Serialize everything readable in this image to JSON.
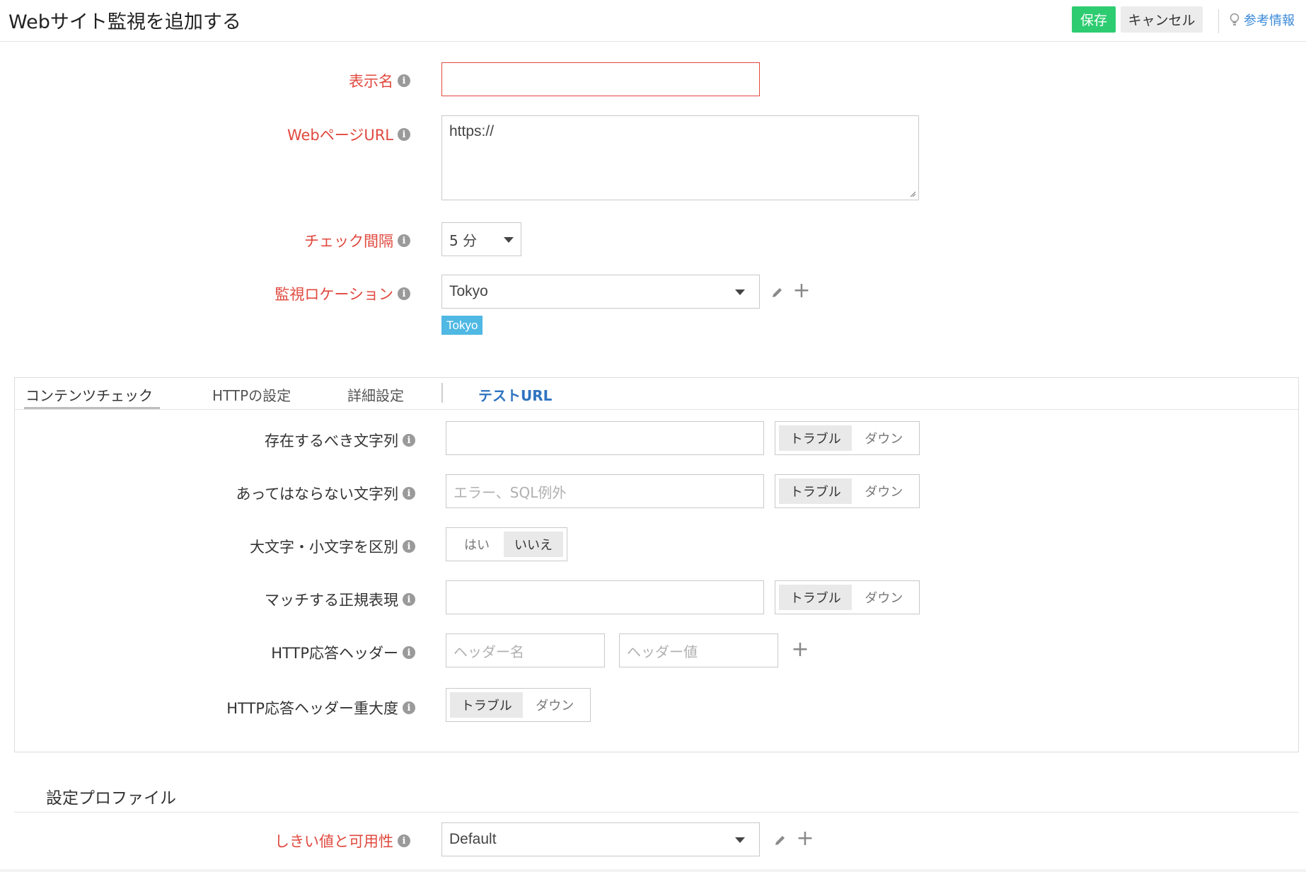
{
  "header": {
    "title": "Webサイト監視を追加する",
    "save_label": "保存",
    "cancel_label": "キャンセル",
    "help_label": "参考情報"
  },
  "form": {
    "display_name": {
      "label": "表示名",
      "value": ""
    },
    "url": {
      "label": "WebページURL",
      "value": "https://"
    },
    "interval": {
      "label": "チェック間隔",
      "value": "5 分"
    },
    "location": {
      "label": "監視ロケーション",
      "value": "Tokyo",
      "tag": "Tokyo"
    }
  },
  "tabs": [
    {
      "label": "コンテンツチェック",
      "active": true
    },
    {
      "label": "HTTPの設定",
      "active": false
    },
    {
      "label": "詳細設定",
      "active": false
    },
    {
      "label": "テストURL",
      "active": false
    }
  ],
  "content": {
    "should_contain": {
      "label": "存在するべき文字列",
      "value": "",
      "opt1": "トラブル",
      "opt2": "ダウン"
    },
    "should_not_contain": {
      "label": "あってはならない文字列",
      "placeholder": "エラー、SQL例外",
      "opt1": "トラブル",
      "opt2": "ダウン"
    },
    "case_sensitive": {
      "label": "大文字・小文字を区別",
      "opt1": "はい",
      "opt2": "いいえ"
    },
    "regex": {
      "label": "マッチする正規表現",
      "value": "",
      "opt1": "トラブル",
      "opt2": "ダウン"
    },
    "http_header": {
      "label": "HTTP応答ヘッダー",
      "name_placeholder": "ヘッダー名",
      "value_placeholder": "ヘッダー値"
    },
    "http_header_severity": {
      "label": "HTTP応答ヘッダー重大度",
      "opt1": "トラブル",
      "opt2": "ダウン"
    }
  },
  "profile": {
    "section_title": "設定プロファイル",
    "threshold": {
      "label": "しきい値と可用性",
      "value": "Default"
    }
  },
  "colors": {
    "required_label": "#e0493e",
    "save_button": "#2ecc71",
    "tag": "#4fb8e3",
    "link": "#3b8ad9",
    "tab_active_blue": "#2f74c0"
  },
  "icons": {
    "info": "info-icon",
    "edit": "pencil-icon",
    "add": "plus-icon",
    "help": "lightbulb-icon",
    "dropdown": "caret-down-icon"
  }
}
